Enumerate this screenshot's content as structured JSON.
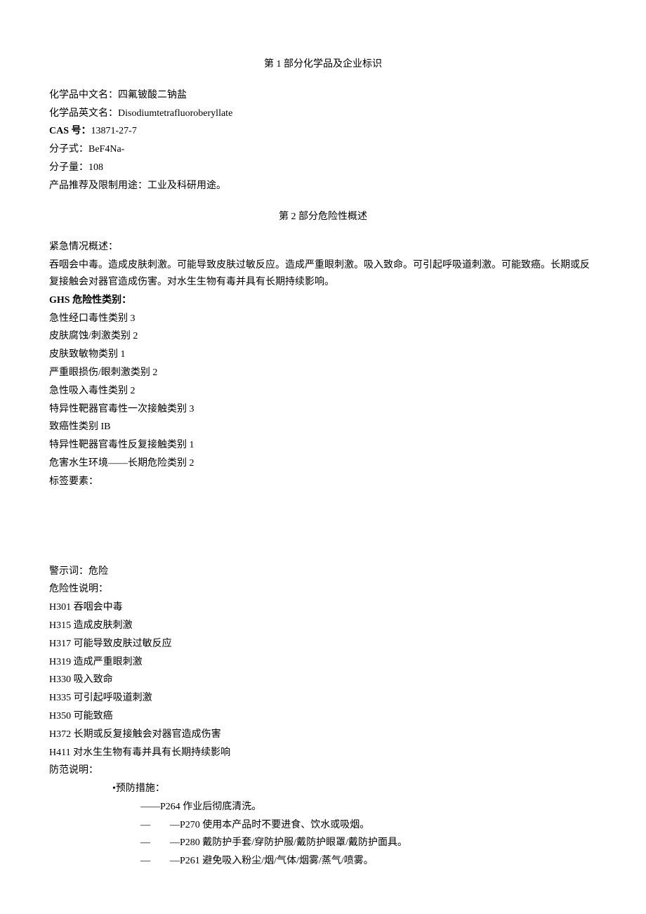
{
  "section1": {
    "title": "第 1 部分化学品及企业标识",
    "fields": {
      "chineseNameLabel": "化学品中文名：",
      "chineseName": "四氟铍酸二钠盐",
      "englishNameLabel": "化学品英文名：",
      "englishName": "Disodiumtetrafluoroberyllate",
      "casLabel": "CAS 号：",
      "casValue": "13871-27-7",
      "formulaLabel": "分子式：",
      "formulaValue": "BeF4Na-",
      "mwLabel": "分子量：",
      "mwValue": "108",
      "useLabel": "产品推荐及限制用途：",
      "useValue": "工业及科研用途。"
    }
  },
  "section2": {
    "title": "第 2 部分危险性概述",
    "emergencyLabel": "紧急情况概述：",
    "emergencyText": "吞咽会中毒。造成皮肤刺激。可能导致皮肤过敏反应。造成严重眼刺激。吸入致命。可引起呼吸道刺激。可能致癌。长期或反复接触会对器官造成伤害。对水生生物有毒并具有长期持续影响。",
    "ghsLabel": "GHS 危险性类别：",
    "ghsItems": [
      "急性经口毒性类别 3",
      "皮肤腐蚀/刺激类别 2",
      "皮肤致敏物类别 1",
      "严重眼损伤/眼刺激类别 2",
      "急性吸入毒性类别 2",
      "特异性靶器官毒性一次接触类别 3",
      "致癌性类别 IB",
      "特异性靶器官毒性反复接触类别 1",
      "危害水生环境——长期危险类别 2"
    ],
    "labelElements": "标签要素：",
    "signalWordLabel": "警示词：",
    "signalWord": "危险",
    "hazardLabel": "危险性说明：",
    "hazardStatements": [
      "H301 吞咽会中毒",
      "H315 造成皮肤刺激",
      "H317 可能导致皮肤过敏反应",
      "H319 造成严重眼刺激",
      "H330 吸入致命",
      "H335 可引起呼吸道刺激",
      "H350 可能致癌",
      "H372 长期或反复接触会对器官造成伤害",
      "H411 对水生生物有毒并具有长期持续影响"
    ],
    "precautionLabel": "防范说明：",
    "preventionHeader": "•预防措施：",
    "preventionItems": [
      "——P264 作业后彻底清洗。",
      "—  —P270 使用本产品时不要进食、饮水或吸烟。",
      "—  —P280 戴防护手套/穿防护服/戴防护眼罩/戴防护面具。",
      "—  —P261 避免吸入粉尘/烟/气体/烟雾/蒸气/喷雾。"
    ]
  }
}
